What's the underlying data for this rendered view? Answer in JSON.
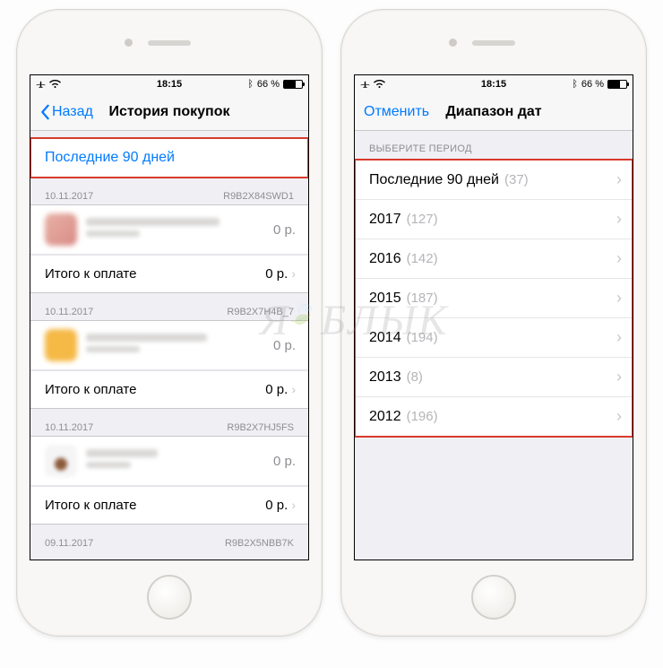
{
  "status": {
    "time": "18:15",
    "battery_text": "66 %"
  },
  "left": {
    "nav": {
      "back": "Назад",
      "title": "История покупок"
    },
    "filter_label": "Последние 90 дней",
    "sections": [
      {
        "date": "10.11.2017",
        "order": "R9B2X84SWD1",
        "price": "0 р.",
        "total_label": "Итого к оплате",
        "total_price": "0 р."
      },
      {
        "date": "10.11.2017",
        "order": "R9B2X7H4B_7",
        "price": "0 р.",
        "total_label": "Итого к оплате",
        "total_price": "0 р."
      },
      {
        "date": "10.11.2017",
        "order": "R9B2X7HJ5FS",
        "price": "0 р.",
        "total_label": "Итого к оплате",
        "total_price": "0 р."
      },
      {
        "date": "09.11.2017",
        "order": "R9B2X5NBB7K"
      }
    ]
  },
  "right": {
    "nav": {
      "back": "Отменить",
      "title": "Диапазон дат"
    },
    "caption": "ВЫБЕРИТЕ ПЕРИОД",
    "options": [
      {
        "label": "Последние 90 дней",
        "count": "(37)"
      },
      {
        "label": "2017",
        "count": "(127)"
      },
      {
        "label": "2016",
        "count": "(142)"
      },
      {
        "label": "2015",
        "count": "(187)"
      },
      {
        "label": "2014",
        "count": "(194)"
      },
      {
        "label": "2013",
        "count": "(8)"
      },
      {
        "label": "2012",
        "count": "(196)"
      }
    ]
  },
  "watermark": "ЯБЛЫК"
}
